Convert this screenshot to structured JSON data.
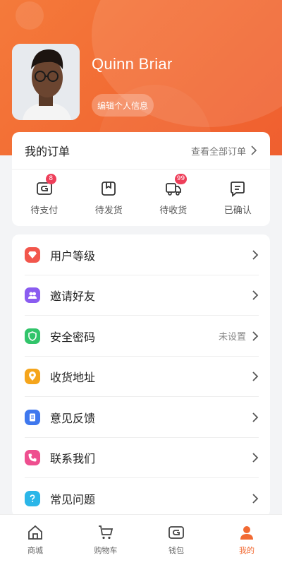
{
  "profile": {
    "name": "Quinn Briar",
    "edit_label": "编辑个人信息"
  },
  "orders": {
    "title": "我的订单",
    "view_all": "查看全部订单",
    "items": [
      {
        "label": "待支付",
        "icon": "pending-payment-icon",
        "badge": "8"
      },
      {
        "label": "待发货",
        "icon": "pending-shipment-icon",
        "badge": ""
      },
      {
        "label": "待收货",
        "icon": "truck-icon",
        "badge": "99"
      },
      {
        "label": "已确认",
        "icon": "confirmed-icon",
        "badge": ""
      }
    ]
  },
  "menu": {
    "items": [
      {
        "label": "用户等级",
        "icon": "diamond-icon",
        "color": "#f2564c",
        "extra": ""
      },
      {
        "label": "邀请好友",
        "icon": "friends-icon",
        "color": "#8a5cf0",
        "extra": ""
      },
      {
        "label": "安全密码",
        "icon": "shield-icon",
        "color": "#31c46a",
        "extra": "未设置"
      },
      {
        "label": "收货地址",
        "icon": "location-icon",
        "color": "#f5a51c",
        "extra": ""
      },
      {
        "label": "意见反馈",
        "icon": "feedback-icon",
        "color": "#3f78ee",
        "extra": ""
      },
      {
        "label": "联系我们",
        "icon": "phone-icon",
        "color": "#ee4f8f",
        "extra": ""
      },
      {
        "label": "常见问题",
        "icon": "question-icon",
        "color": "#2bb6e8",
        "extra": ""
      }
    ]
  },
  "tabbar": {
    "items": [
      {
        "label": "商城",
        "icon": "home-icon",
        "active": false
      },
      {
        "label": "购物车",
        "icon": "cart-icon",
        "active": false
      },
      {
        "label": "钱包",
        "icon": "wallet-icon",
        "active": false
      },
      {
        "label": "我的",
        "icon": "user-icon",
        "active": true
      }
    ]
  },
  "colors": {
    "accent": "#f26a33",
    "badge": "#ee3f5a"
  }
}
